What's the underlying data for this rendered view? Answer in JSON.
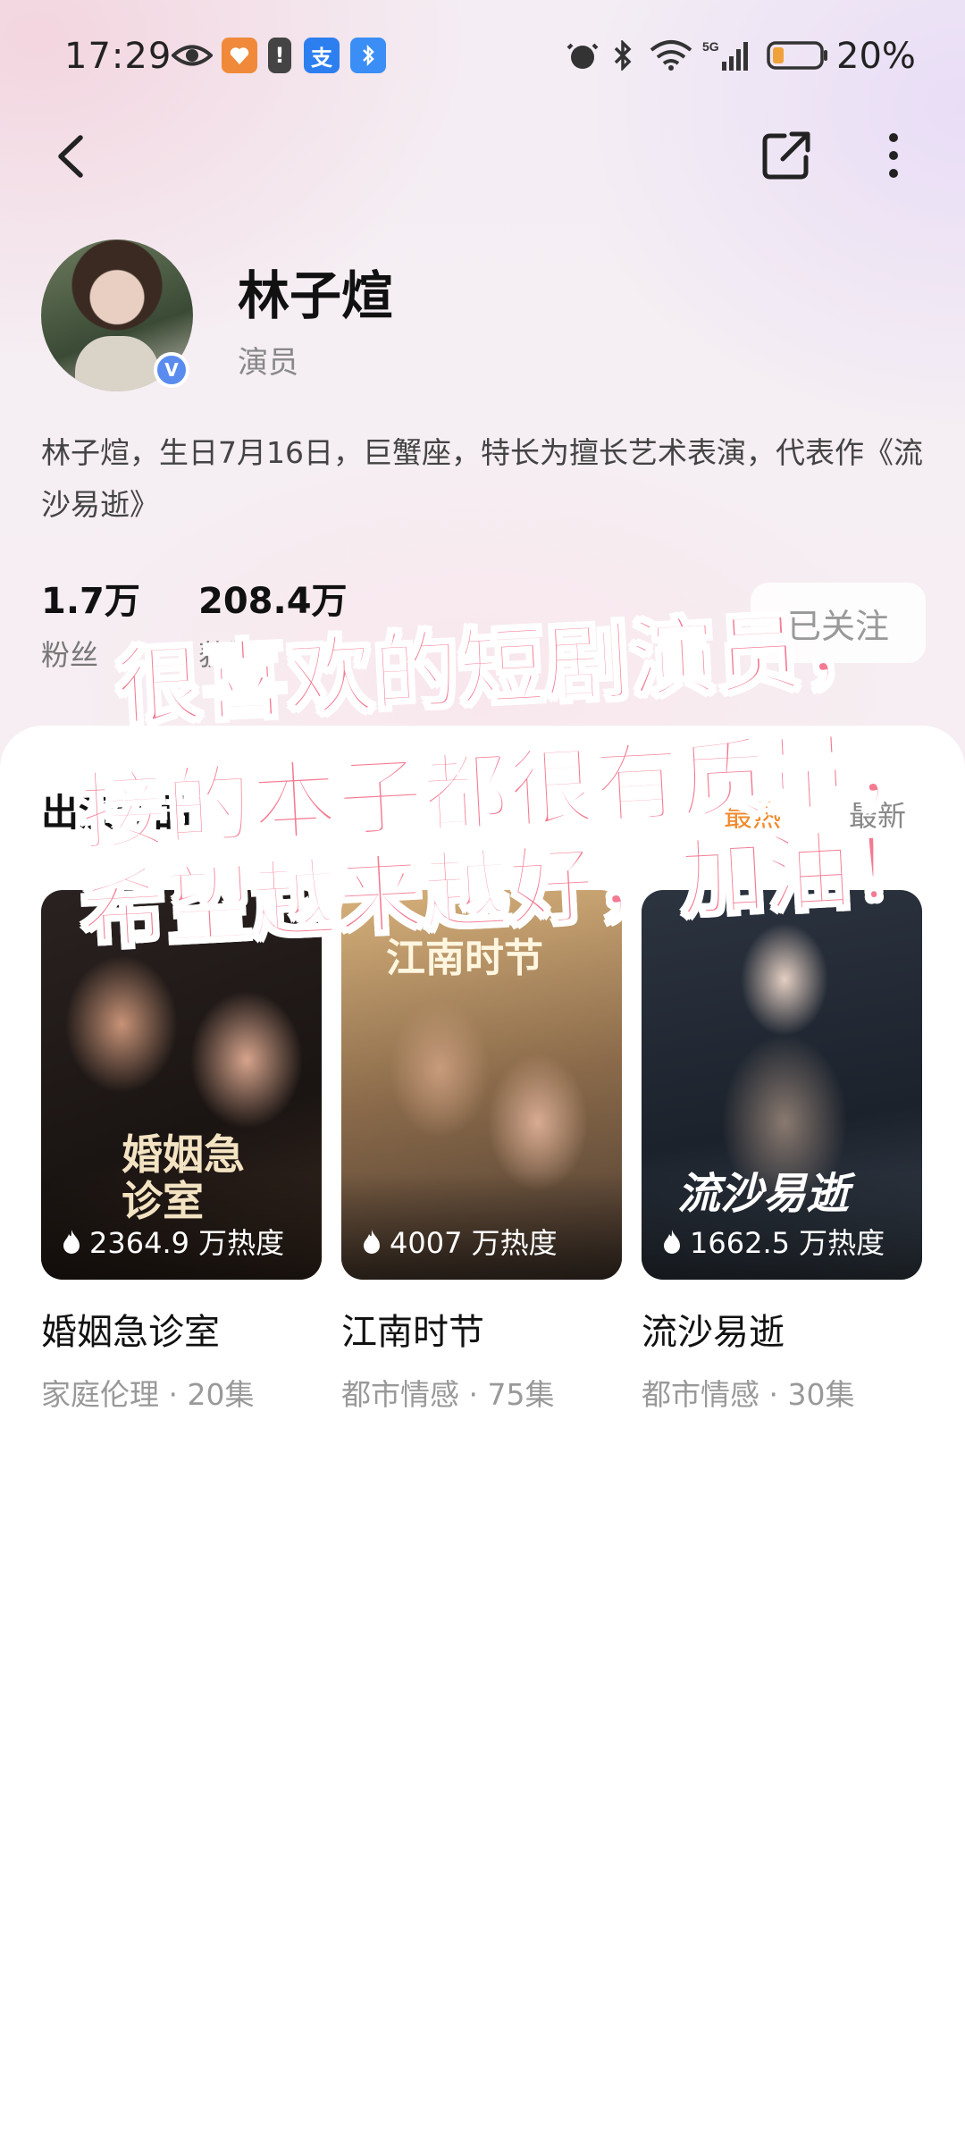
{
  "status_bar": {
    "time": "17:29",
    "app_badge_1": "支",
    "battery_percent": "20%",
    "network": "5G"
  },
  "header": {
    "back_icon": "chevron-left-icon",
    "share_icon": "share-icon",
    "more_icon": "more-vertical-icon"
  },
  "profile": {
    "name": "林子煊",
    "role": "演员",
    "verified_mark": "V",
    "bio": "林子煊，生日7月16日，巨蟹座，特长为擅长艺术表演，代表作《流沙易逝》",
    "stats": [
      {
        "value": "1.7万",
        "label": "粉丝"
      },
      {
        "value": "208.4万",
        "label": "获赞"
      }
    ],
    "follow_button": "已关注"
  },
  "works": {
    "section_title": "出演作品",
    "sort_hot": "最热",
    "sort_new": "最新",
    "items": [
      {
        "title": "婚姻急诊室",
        "meta": "家庭伦理 · 20集",
        "heat": "2364.9 万热度",
        "poster_text": "婚姻急诊室"
      },
      {
        "title": "江南时节",
        "meta": "都市情感 · 75集",
        "heat": "4007 万热度",
        "poster_text": "江南时节"
      },
      {
        "title": "流沙易逝",
        "meta": "都市情感 · 30集",
        "heat": "1662.5 万热度",
        "poster_text": "流沙易逝"
      }
    ]
  },
  "overlay_caption": {
    "line1": "很喜欢的短剧演员，",
    "line2": "接的本子都很有质量，",
    "line3": "希望越来越好，加油！"
  },
  "colors": {
    "overlay_text": "#f47a92",
    "accent_orange": "#f08a2b",
    "verified_blue": "#5a8cf0"
  }
}
